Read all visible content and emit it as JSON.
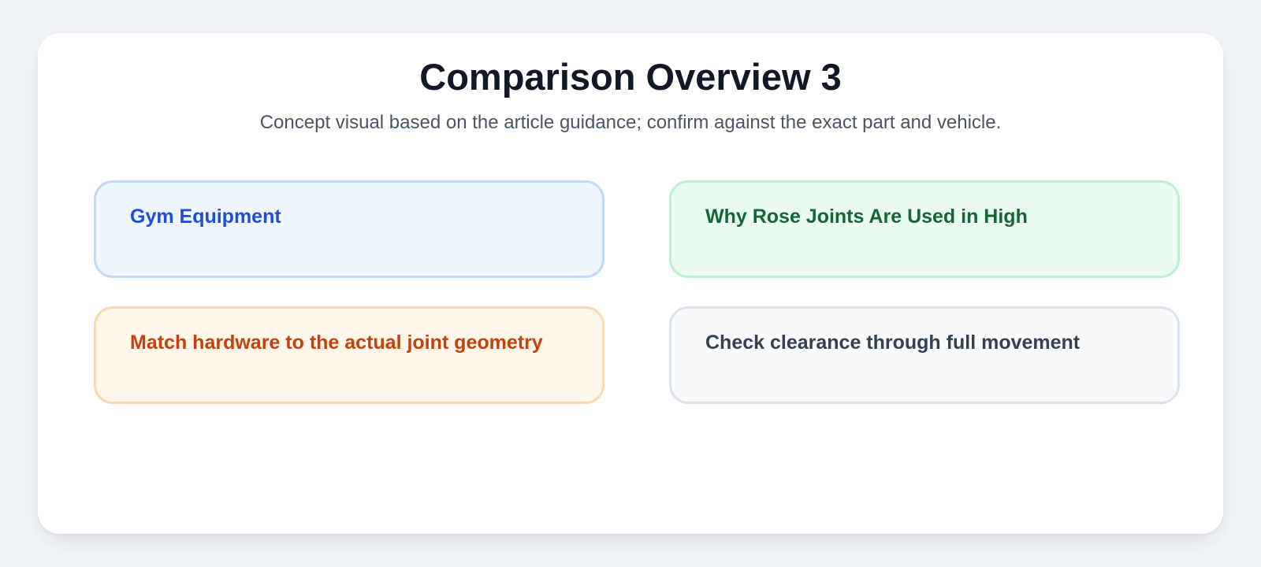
{
  "header": {
    "title": "Comparison Overview 3",
    "subtitle": "Concept visual based on the article guidance; confirm against the exact part and vehicle."
  },
  "panels": [
    {
      "label": "Gym Equipment",
      "accent": "#1d4ed8"
    },
    {
      "label": "Why Rose Joints Are Used in High",
      "accent": "#166534"
    },
    {
      "label": "Match hardware to the actual joint geometry",
      "accent": "#c2410c"
    },
    {
      "label": "Check clearance through full movement",
      "accent": "#334155"
    }
  ]
}
